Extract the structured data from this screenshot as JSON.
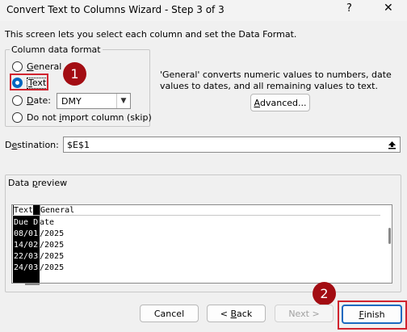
{
  "window": {
    "title": "Convert Text to Columns Wizard - Step 3 of 3",
    "help_glyph": "?",
    "close_glyph": "✕"
  },
  "intro_text": "This screen lets you select each column and set the Data Format.",
  "column_format": {
    "legend": "Column data format",
    "options": [
      {
        "label_pre": "",
        "mnemonic": "G",
        "label_post": "eneral",
        "checked": false
      },
      {
        "label_pre": "",
        "mnemonic": "T",
        "label_post": "ext",
        "checked": true
      },
      {
        "label_pre": "",
        "mnemonic": "D",
        "label_post": "ate:",
        "checked": false
      },
      {
        "label_pre": "Do not ",
        "mnemonic": "i",
        "label_post": "mport column (skip)",
        "checked": false
      }
    ],
    "date_format_value": "DMY"
  },
  "description": "'General' converts numeric values to numbers, date values to dates, and all remaining values to text.",
  "advanced_label_pre": "",
  "advanced_mnemonic": "A",
  "advanced_label_post": "dvanced...",
  "destination": {
    "label_pre": "D",
    "label_mnemonic": "e",
    "label_post": "stination:",
    "value": "$E$1"
  },
  "preview": {
    "legend_pre": "Data ",
    "legend_mnemonic": "p",
    "legend_post": "review",
    "headers": [
      "Text",
      "General"
    ],
    "rows": [
      {
        "sel": "Due D",
        "rest": "ate"
      },
      {
        "sel": "08/01",
        "rest": "/2025"
      },
      {
        "sel": "14/02",
        "rest": "/2025"
      },
      {
        "sel": "22/03",
        "rest": "/2025"
      },
      {
        "sel": "24/03",
        "rest": "/2025"
      }
    ]
  },
  "callouts": [
    "1",
    "2"
  ],
  "buttons": {
    "cancel": "Cancel",
    "back_pre": "< ",
    "back_mnemonic": "B",
    "back_post": "ack",
    "next": "Next >",
    "finish_mnemonic": "F",
    "finish_post": "inish"
  },
  "colors": {
    "highlight": "#d1242f",
    "callout": "#a30d13",
    "accent": "#0067c0"
  }
}
